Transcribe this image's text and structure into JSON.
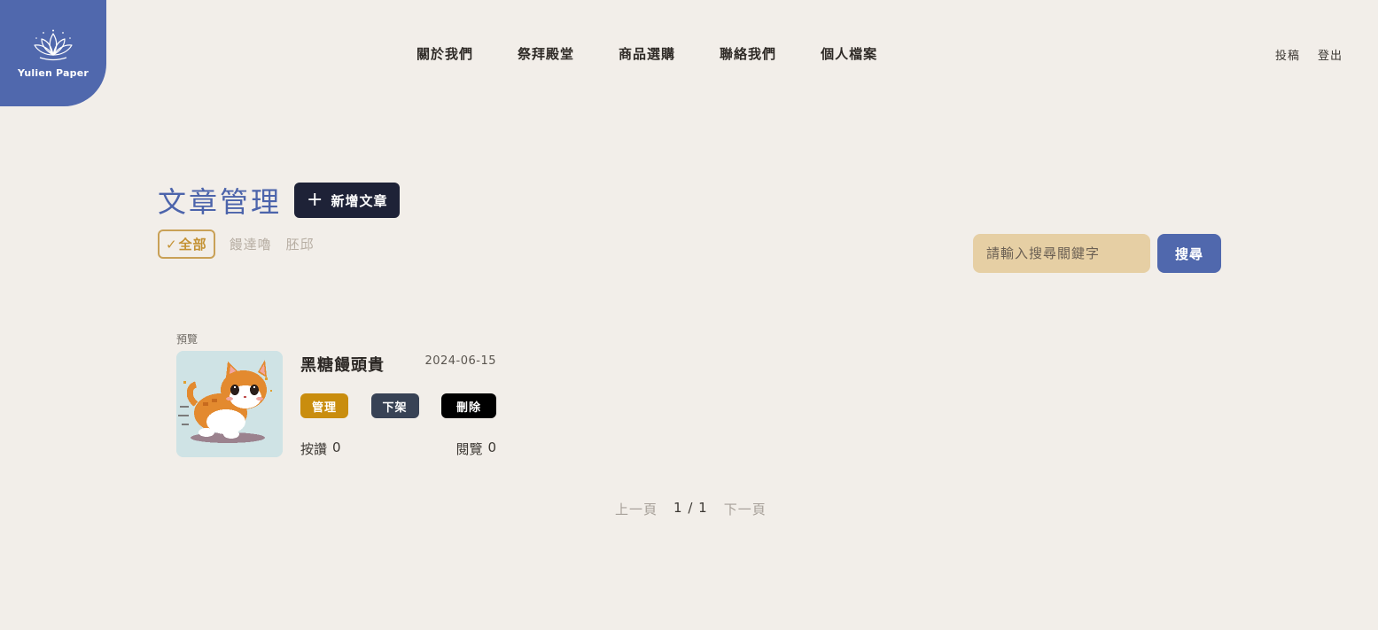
{
  "brand": {
    "name": "Yulien Paper",
    "color": "#5068ad",
    "icon": "lotus-icon"
  },
  "nav": {
    "items": [
      "關於我們",
      "祭拜殿堂",
      "商品選購",
      "聯絡我們",
      "個人檔案"
    ],
    "right": [
      "投稿",
      "登出"
    ]
  },
  "page": {
    "title": "文章管理",
    "new_button": "新增文章",
    "new_icon": "plus-icon"
  },
  "filters": {
    "active_mark": "✓",
    "items": [
      "全部",
      "饅達嚕",
      "胚邱"
    ],
    "active_index": 0
  },
  "search": {
    "placeholder": "請輸入搜尋關鍵字",
    "value": "",
    "button": "搜尋"
  },
  "articles": [
    {
      "preview_label": "預覽",
      "title": "黑糖饅頭貴",
      "date": "2024-06-15",
      "thumbnail": "pixel-cat-illustration",
      "buttons": {
        "manage": "管理",
        "unlist": "下架",
        "delete": "刪除"
      },
      "likes_label": "按讚",
      "likes": "0",
      "views_label": "閱覽",
      "views": "0"
    }
  ],
  "pagination": {
    "prev": "上一頁",
    "current": "1 / 1",
    "next": "下一頁"
  },
  "colors": {
    "background": "#f2eee9",
    "primary": "#5068ad",
    "accent_gold": "#c98d0e",
    "search_bg": "#e6cfa4",
    "dark_button": "#1e2237"
  }
}
